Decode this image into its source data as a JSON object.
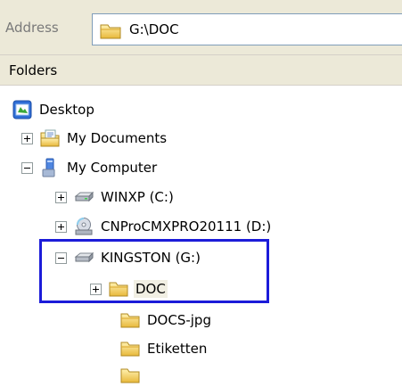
{
  "address_bar": {
    "label": "Address",
    "value": "G:\\DOC"
  },
  "folders_panel": {
    "title": "Folders"
  },
  "tree": {
    "desktop": "Desktop",
    "my_documents": "My Documents",
    "my_computer": "My Computer",
    "winxp": "WINXP (C:)",
    "cnpro": "CNProCMXPRO20111 (D:)",
    "kingston": "KINGSTON (G:)",
    "doc": "DOC",
    "docs_jpg": "DOCS-jpg",
    "etiketten": "Etiketten"
  },
  "colors": {
    "highlight_box": "#1c1cd9",
    "toolbar_bg": "#ece9d8"
  }
}
